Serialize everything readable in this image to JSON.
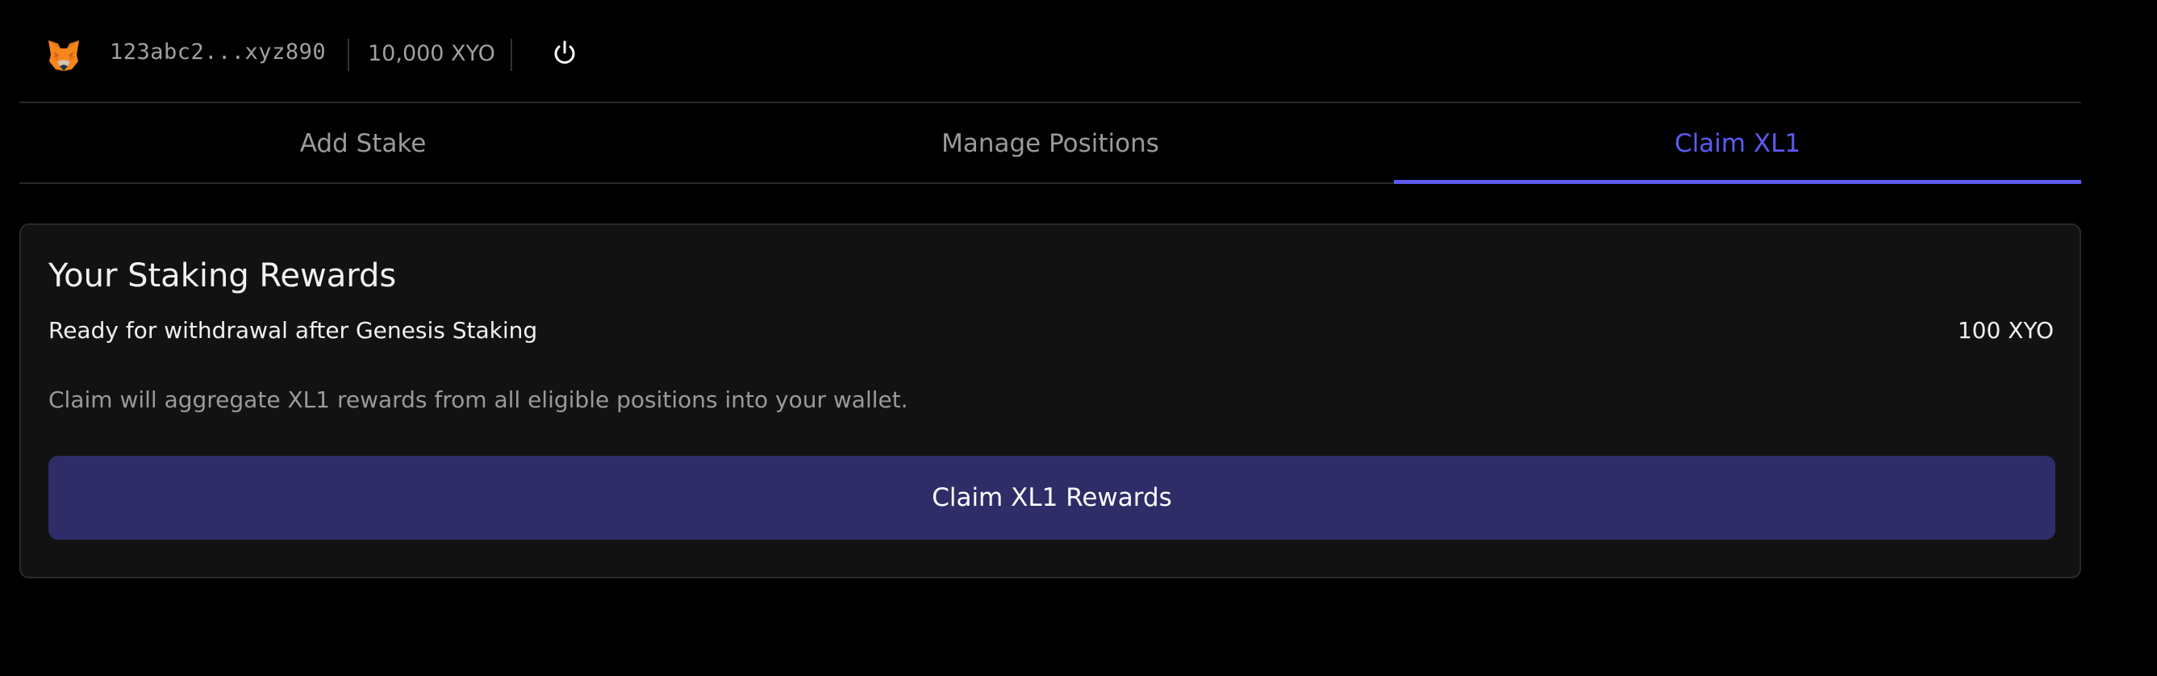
{
  "header": {
    "wallet_icon": "metamask-fox-icon",
    "address": "123abc2...xyz890",
    "balance": "10,000 XYO",
    "power_icon": "power-icon"
  },
  "tabs": [
    {
      "label": "Add Stake",
      "active": false
    },
    {
      "label": "Manage Positions",
      "active": false
    },
    {
      "label": "Claim XL1",
      "active": true
    }
  ],
  "rewards": {
    "title": "Your Staking Rewards",
    "row_label": "Ready for withdrawal after Genesis Staking",
    "row_value": "100 XYO",
    "note": "Claim will aggregate XL1 rewards from all eligible positions into your wallet.",
    "button_label": "Claim XL1 Rewards"
  },
  "colors": {
    "background": "#000000",
    "card": "#121212",
    "accent": "#5b5bf0",
    "button": "#2e2d68",
    "muted_text": "#9a9a9a"
  }
}
